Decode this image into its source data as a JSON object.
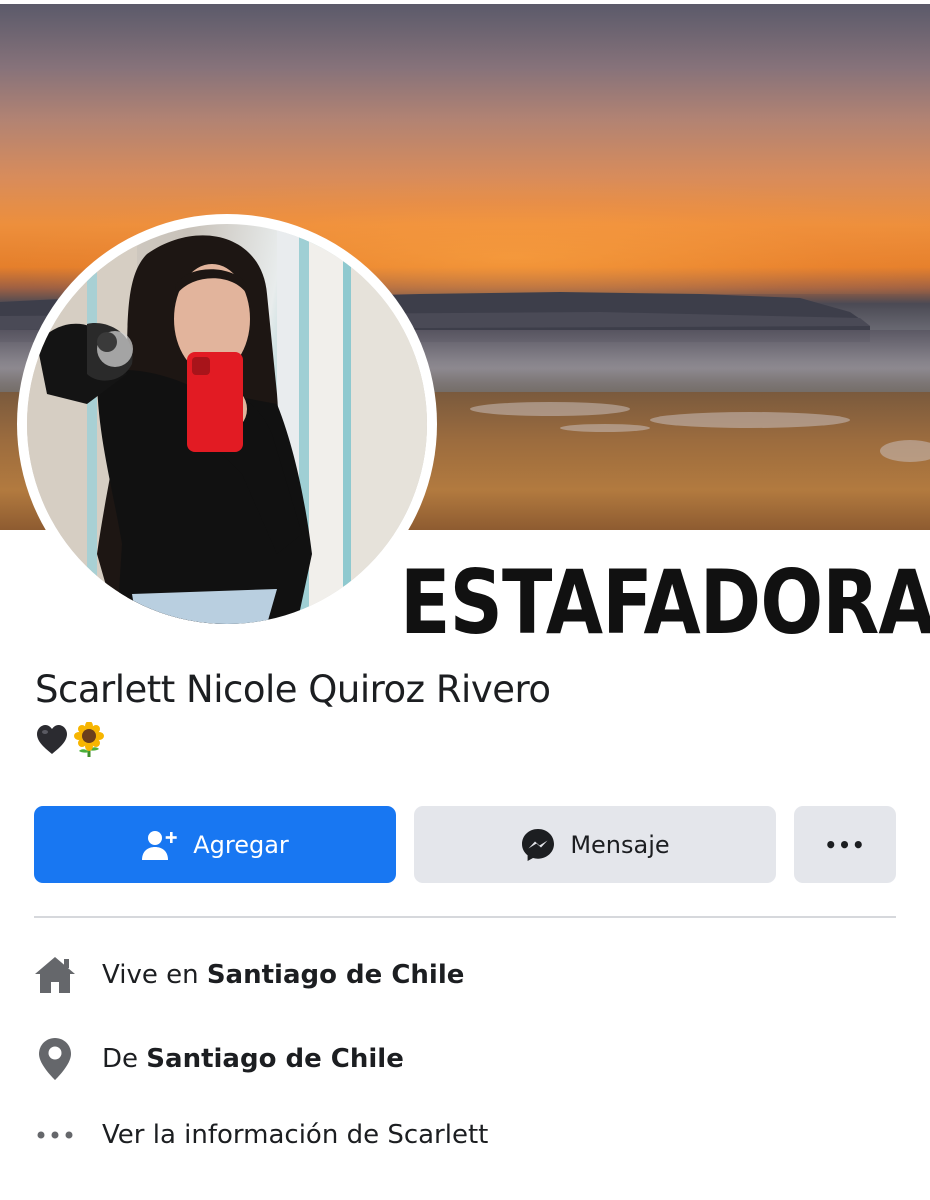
{
  "overlay": {
    "stamp_text": "ESTAFADORA"
  },
  "profile": {
    "name": "Scarlett Nicole Quiroz Rivero",
    "bio_emojis": [
      "🖤",
      "🌻"
    ]
  },
  "actions": {
    "add_label": "Agregar",
    "message_label": "Mensaje",
    "more_label": "•••"
  },
  "intro": {
    "lives_prefix": "Vive en",
    "lives_city": "Santiago de Chile",
    "from_prefix": "De",
    "from_city": "Santiago de Chile",
    "see_info": "Ver la información de Scarlett"
  },
  "icons": {
    "add": "add-friend-icon",
    "message": "messenger-icon",
    "more": "more-icon",
    "home": "home-icon",
    "location": "location-pin-icon",
    "info_more": "more-dots-icon"
  },
  "colors": {
    "primary": "#1877f2",
    "button_secondary": "#e4e6eb",
    "icon_gray": "#65676b"
  }
}
